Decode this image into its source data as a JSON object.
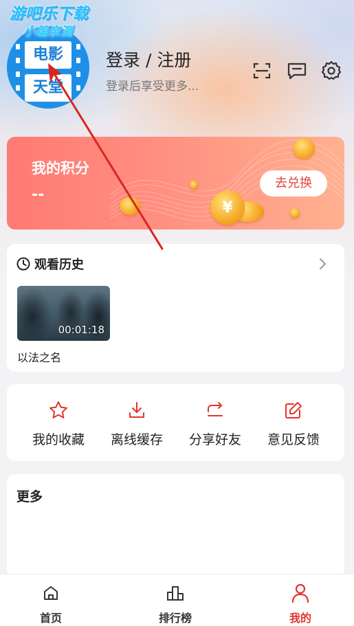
{
  "watermark": {
    "line1": "游吧乐下载",
    "line2": "小编亲测"
  },
  "avatar": {
    "line1": "电影",
    "line2": "天堂"
  },
  "header": {
    "login_title": "登录 / 注册",
    "login_subtitle": "登录后享受更多...",
    "icons": [
      "scan-icon",
      "message-icon",
      "settings-icon"
    ]
  },
  "points": {
    "label": "我的积分",
    "value": "--",
    "redeem_label": "去兑换"
  },
  "history": {
    "title": "观看历史",
    "items": [
      {
        "title": "以法之名",
        "progress_time": "00:01:18"
      }
    ]
  },
  "actions": [
    {
      "label": "我的收藏",
      "icon": "star-icon"
    },
    {
      "label": "离线缓存",
      "icon": "download-icon"
    },
    {
      "label": "分享好友",
      "icon": "share-icon"
    },
    {
      "label": "意见反馈",
      "icon": "edit-icon"
    }
  ],
  "more": {
    "title": "更多"
  },
  "tabbar": {
    "tabs": [
      {
        "label": "首页",
        "icon": "home-icon",
        "active": false
      },
      {
        "label": "排行榜",
        "icon": "ranking-icon",
        "active": false
      },
      {
        "label": "我的",
        "icon": "user-icon",
        "active": true
      }
    ]
  },
  "colors": {
    "accent": "#e4342a",
    "points_gradient_start": "#ff7a73",
    "points_gradient_end": "#ffb190",
    "avatar_blue": "#1e8fe6"
  }
}
